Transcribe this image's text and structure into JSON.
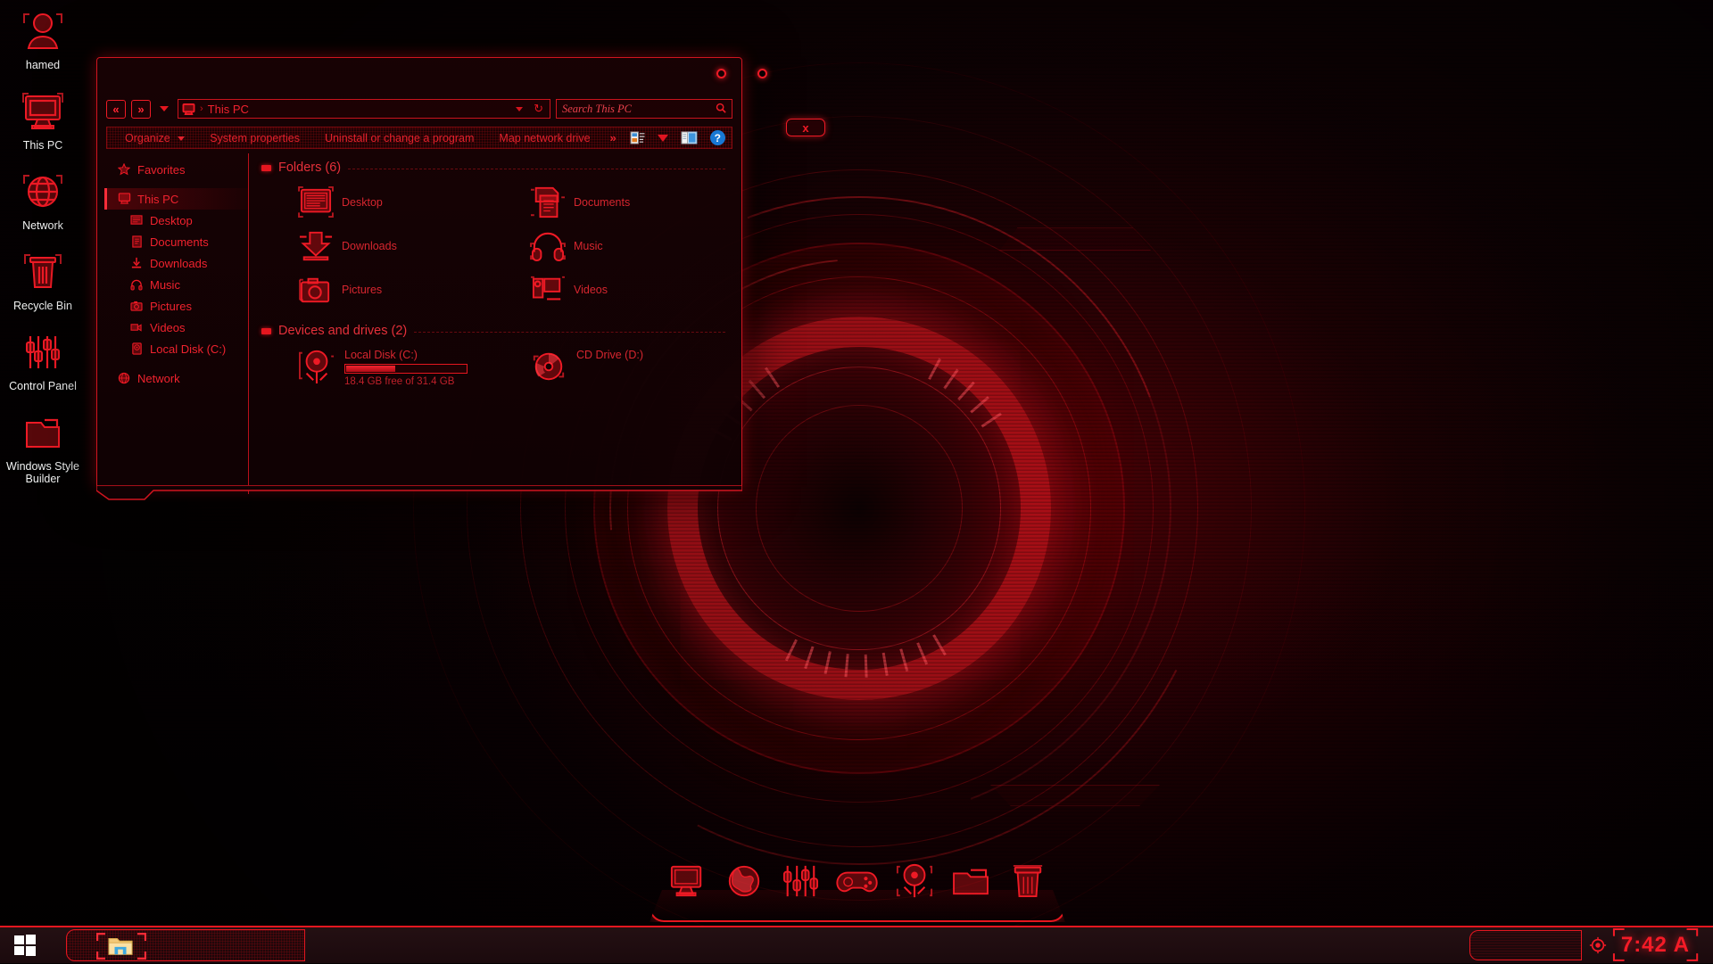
{
  "theme": {
    "accent": "#ee1a25",
    "accent_bright": "#ff2d39",
    "accent_dim": "#c0202a",
    "background": "#050102",
    "help_blue": "#1878d4"
  },
  "desktop": {
    "icons": [
      {
        "label": "hamed",
        "icon": "user-icon"
      },
      {
        "label": "This PC",
        "icon": "monitor-icon"
      },
      {
        "label": "Network",
        "icon": "globe-icon"
      },
      {
        "label": "Recycle Bin",
        "icon": "trash-icon"
      },
      {
        "label": "Control Panel",
        "icon": "sliders-icon"
      },
      {
        "label": "Windows Style Builder",
        "icon": "folder-icon"
      }
    ]
  },
  "explorer": {
    "titlebar": {
      "minimize_label": "○",
      "maximize_label": "○",
      "close_label": "x"
    },
    "nav": {
      "back_label": "«",
      "forward_label": "»",
      "address_value": "This PC",
      "crumb_separator": "›",
      "refresh_label": "↻"
    },
    "search": {
      "placeholder": "Search This PC",
      "icon": "search-icon"
    },
    "command_bar": {
      "items": [
        {
          "label": "Organize",
          "has_caret": true
        },
        {
          "label": "System properties",
          "has_caret": false
        },
        {
          "label": "Uninstall or change a program",
          "has_caret": false
        },
        {
          "label": "Map network drive",
          "has_caret": false
        }
      ],
      "overflow_label": "»",
      "icons": [
        {
          "name": "view-options-icon"
        },
        {
          "name": "view-dropdown-caret-icon"
        },
        {
          "name": "preview-pane-icon"
        },
        {
          "name": "help-icon",
          "label": "?"
        }
      ]
    },
    "nav_pane": [
      {
        "label": "Favorites",
        "icon": "star-icon",
        "level": 0,
        "selected": false
      },
      {
        "label": "This PC",
        "icon": "monitor-icon",
        "level": 0,
        "selected": true
      },
      {
        "label": "Desktop",
        "icon": "desktop-icon",
        "level": 1,
        "selected": false
      },
      {
        "label": "Documents",
        "icon": "documents-icon",
        "level": 1,
        "selected": false
      },
      {
        "label": "Downloads",
        "icon": "downloads-icon",
        "level": 1,
        "selected": false
      },
      {
        "label": "Music",
        "icon": "music-icon",
        "level": 1,
        "selected": false
      },
      {
        "label": "Pictures",
        "icon": "pictures-icon",
        "level": 1,
        "selected": false
      },
      {
        "label": "Videos",
        "icon": "videos-icon",
        "level": 1,
        "selected": false
      },
      {
        "label": "Local Disk (C:)",
        "icon": "harddrive-icon",
        "level": 1,
        "selected": false
      },
      {
        "label": "Network",
        "icon": "globe-icon",
        "level": 0,
        "selected": false
      }
    ],
    "groups": {
      "folders": {
        "title": "Folders (6)",
        "items": [
          {
            "label": "Desktop",
            "icon": "desktop-icon"
          },
          {
            "label": "Documents",
            "icon": "documents-icon"
          },
          {
            "label": "Downloads",
            "icon": "downloads-icon"
          },
          {
            "label": "Music",
            "icon": "music-icon"
          },
          {
            "label": "Pictures",
            "icon": "pictures-icon"
          },
          {
            "label": "Videos",
            "icon": "videos-icon"
          }
        ]
      },
      "devices": {
        "title": "Devices and drives (2)",
        "items": [
          {
            "label": "Local Disk (C:)",
            "icon": "harddrive-icon",
            "capacity_text": "18.4 GB free of 31.4 GB",
            "used_percent": 41,
            "free_gb": 18.4,
            "total_gb": 31.4
          },
          {
            "label": "CD Drive (D:)",
            "icon": "cd-icon",
            "capacity_text": "",
            "used_percent": 0
          }
        ]
      }
    }
  },
  "dock": {
    "items": [
      {
        "name": "monitor-icon",
        "label": "Computer"
      },
      {
        "name": "globe-icon",
        "label": "Internet"
      },
      {
        "name": "sliders-icon",
        "label": "Control Panel"
      },
      {
        "name": "gamepad-icon",
        "label": "Games"
      },
      {
        "name": "harddrive-icon",
        "label": "Drives"
      },
      {
        "name": "folder-icon",
        "label": "Documents"
      },
      {
        "name": "trash-icon",
        "label": "Recycle Bin"
      }
    ]
  },
  "taskbar": {
    "start_label": "Start",
    "pinned": [
      {
        "name": "file-explorer-icon",
        "label": "File Explorer",
        "active": true
      }
    ],
    "clock": "7:42 A",
    "clock_icon": "target-icon"
  }
}
